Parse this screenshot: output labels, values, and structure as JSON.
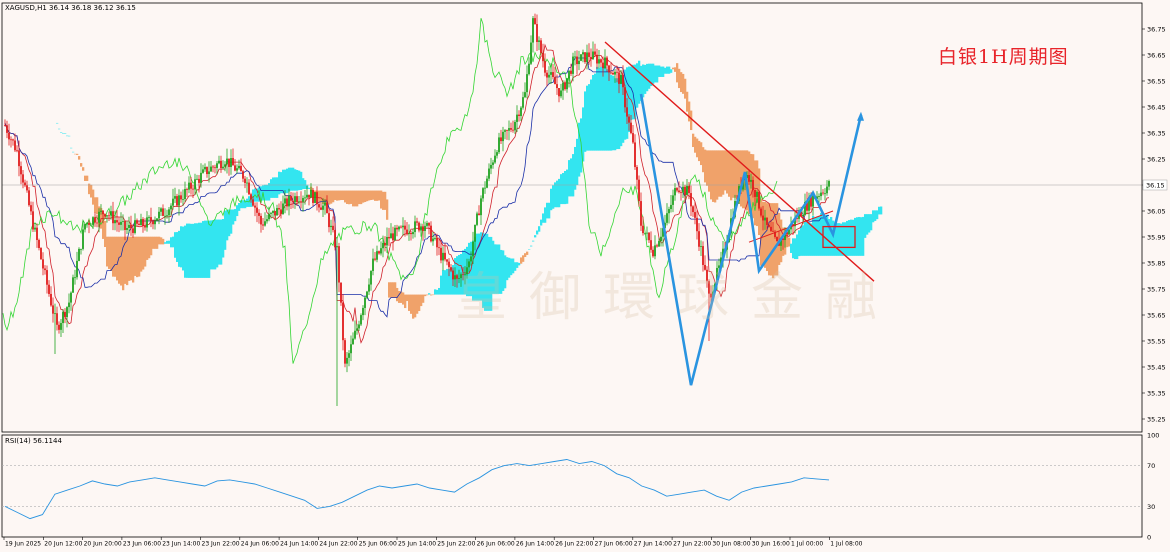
{
  "symbol_header": "XAGUSD,H1  36.14 36.18 36.12 36.15",
  "annotation_title": "白银1H周期图",
  "watermark_text": "皇御環球金融",
  "rsi_label": "RSI(14) 56.1144",
  "colors": {
    "background": "#fdf7f4",
    "bull_candle": "#1fa21f",
    "bear_candle": "#e01b1b",
    "tenkan": "#d0202a",
    "kijun": "#1a2fa8",
    "chikou": "#33d633",
    "cloud_bull": "#33e5f0",
    "cloud_bear": "#f0a26a",
    "trendline": "#e01b1b",
    "projection": "#2a94e0",
    "rsi_line": "#2a94e0",
    "current_price_line": "#a0a0a0"
  },
  "chart_data": {
    "type": "candlestick",
    "timeframe": "H1",
    "symbol": "XAGUSD",
    "price_axis": {
      "ylim": [
        35.2,
        36.85
      ],
      "ticks": [
        "36.75",
        "36.65",
        "36.55",
        "36.45",
        "36.35",
        "36.25",
        "36.15",
        "36.05",
        "35.95",
        "35.85",
        "35.75",
        "35.65",
        "35.55",
        "35.45",
        "35.35",
        "35.25"
      ]
    },
    "current_price": "36.15",
    "time_labels": [
      "19 Jun 2025",
      "20 Jun 12:00",
      "20 Jun 20:00",
      "23 Jun 06:00",
      "23 Jun 14:00",
      "23 Jun 22:00",
      "24 Jun 06:00",
      "24 Jun 14:00",
      "24 Jun 22:00",
      "25 Jun 06:00",
      "25 Jun 14:00",
      "25 Jun 22:00",
      "26 Jun 06:00",
      "26 Jun 14:00",
      "26 Jun 22:00",
      "27 Jun 06:00",
      "27 Jun 14:00",
      "27 Jun 22:00",
      "30 Jun 08:00",
      "30 Jun 16:00",
      "1 Jul 00:00",
      "1 Jul 08:00"
    ],
    "price_path": [
      [
        0,
        36.38
      ],
      [
        6,
        36.28
      ],
      [
        14,
        36.0
      ],
      [
        20,
        35.8
      ],
      [
        26,
        35.6
      ],
      [
        32,
        35.7
      ],
      [
        40,
        36.0
      ],
      [
        50,
        36.05
      ],
      [
        60,
        35.98
      ],
      [
        70,
        36.0
      ],
      [
        80,
        36.05
      ],
      [
        90,
        36.12
      ],
      [
        100,
        36.2
      ],
      [
        110,
        36.25
      ],
      [
        120,
        36.18
      ],
      [
        128,
        36.0
      ],
      [
        136,
        36.05
      ],
      [
        144,
        36.1
      ],
      [
        152,
        36.12
      ],
      [
        160,
        36.06
      ],
      [
        166,
        35.9
      ],
      [
        170,
        35.45
      ],
      [
        176,
        35.6
      ],
      [
        184,
        35.85
      ],
      [
        192,
        35.95
      ],
      [
        200,
        35.98
      ],
      [
        210,
        36.0
      ],
      [
        218,
        35.88
      ],
      [
        226,
        35.78
      ],
      [
        232,
        35.85
      ],
      [
        238,
        36.1
      ],
      [
        246,
        36.3
      ],
      [
        254,
        36.38
      ],
      [
        260,
        36.5
      ],
      [
        264,
        36.78
      ],
      [
        270,
        36.6
      ],
      [
        278,
        36.5
      ],
      [
        284,
        36.62
      ],
      [
        292,
        36.65
      ],
      [
        300,
        36.62
      ],
      [
        308,
        36.55
      ],
      [
        314,
        36.3
      ],
      [
        318,
        36.0
      ],
      [
        324,
        35.9
      ],
      [
        330,
        36.0
      ],
      [
        336,
        36.15
      ],
      [
        342,
        36.12
      ],
      [
        348,
        35.9
      ],
      [
        352,
        35.72
      ],
      [
        358,
        35.85
      ],
      [
        364,
        36.05
      ],
      [
        370,
        36.2
      ],
      [
        374,
        36.15
      ],
      [
        380,
        36.0
      ],
      [
        386,
        35.92
      ],
      [
        392,
        35.98
      ],
      [
        398,
        36.05
      ],
      [
        404,
        36.1
      ],
      [
        412,
        36.15
      ]
    ],
    "range_high": 36.8,
    "range_low": 35.28,
    "indicators": [
      "Ichimoku Kinko Hyo",
      "RSI(14)"
    ],
    "rsi": {
      "name": "RSI(14)",
      "last_value": 56.1144,
      "ylim": [
        0,
        100
      ],
      "levels": [
        30,
        70
      ],
      "ticks": [
        "100",
        "70",
        "30",
        "0"
      ],
      "values": [
        30,
        24,
        18,
        22,
        42,
        46,
        50,
        55,
        52,
        50,
        54,
        56,
        58,
        56,
        54,
        52,
        50,
        55,
        56,
        54,
        52,
        48,
        44,
        40,
        36,
        28,
        30,
        34,
        40,
        46,
        50,
        48,
        50,
        52,
        48,
        46,
        44,
        52,
        58,
        66,
        70,
        72,
        70,
        72,
        74,
        76,
        72,
        74,
        70,
        62,
        58,
        50,
        46,
        40,
        42,
        44,
        46,
        40,
        36,
        44,
        48,
        50,
        52,
        54,
        58,
        57,
        56
      ]
    },
    "annotations": {
      "trendline": "descending resistance from 36.70 to 35.78",
      "projection": "zig-zag scenario targeting 36.42",
      "highlight_box": "around 35.95"
    }
  }
}
